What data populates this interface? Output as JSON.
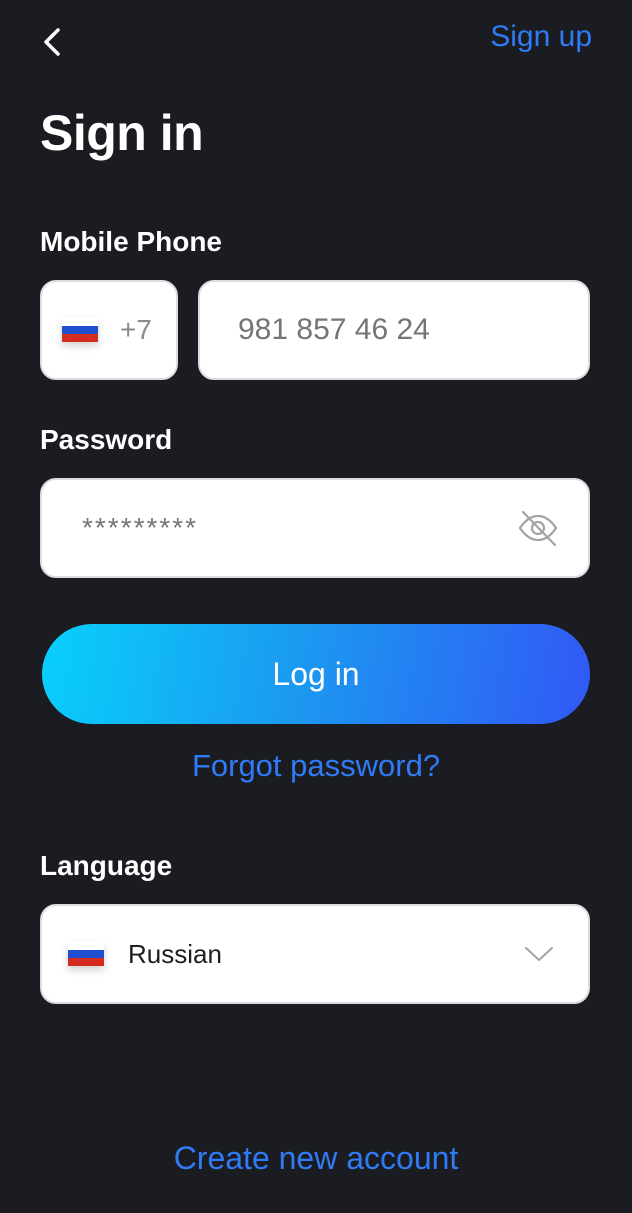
{
  "header": {
    "signup_label": "Sign up",
    "title": "Sign in"
  },
  "phone": {
    "label": "Mobile Phone",
    "country_code": "+7",
    "placeholder": "981 857 46 24"
  },
  "password": {
    "label": "Password",
    "placeholder": "*********"
  },
  "actions": {
    "login_label": "Log in",
    "forgot_label": "Forgot password?",
    "create_label": "Create new account"
  },
  "language": {
    "label": "Language",
    "selected": "Russian"
  },
  "icons": {
    "back": "chevron-left-icon",
    "password_toggle": "eye-off-icon",
    "dropdown": "chevron-down-icon",
    "flag": "russia-flag-icon"
  },
  "colors": {
    "background": "#1b1c21",
    "accent": "#2f7bf5",
    "gradient_start": "#08d0fc",
    "gradient_end": "#3158f5",
    "flag_white": "#ffffff",
    "flag_blue": "#1f4fd0",
    "flag_red": "#d52b1e"
  }
}
